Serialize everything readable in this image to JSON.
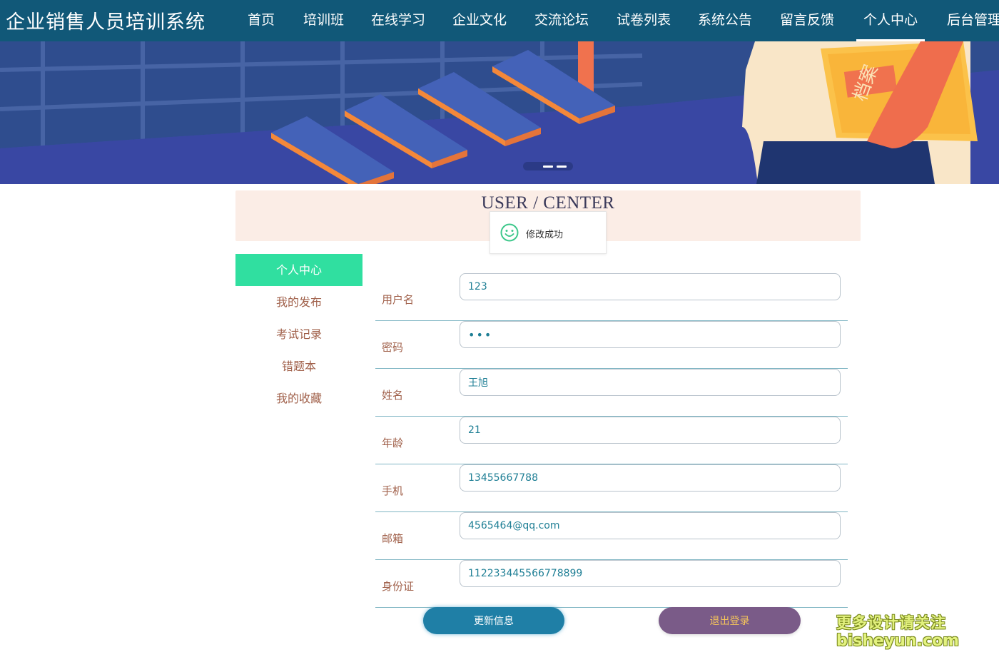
{
  "header": {
    "site_title": "企业销售人员培训系统",
    "nav": [
      "首页",
      "培训班",
      "在线学习",
      "企业文化",
      "交流论坛",
      "试卷列表",
      "系统公告",
      "留言反馈",
      "个人中心",
      "后台管理"
    ],
    "active_nav": "个人中心"
  },
  "banner": {
    "folder_text": "档案"
  },
  "user_center": {
    "title": "USER / CENTER"
  },
  "toast": {
    "icon": "smile-icon",
    "message": "修改成功"
  },
  "side_menu": {
    "items": [
      "个人中心",
      "我的发布",
      "考试记录",
      "错题本",
      "我的收藏"
    ],
    "active": "个人中心"
  },
  "form": {
    "fields": [
      {
        "label": "用户名",
        "value": "123"
      },
      {
        "label": "密码",
        "value": "123"
      },
      {
        "label": "姓名",
        "value": "王旭"
      },
      {
        "label": "年龄",
        "value": "21"
      },
      {
        "label": "手机",
        "value": "13455667788"
      },
      {
        "label": "邮箱",
        "value": "4565464@qq.com"
      },
      {
        "label": "身份证",
        "value": "112233445566778899"
      }
    ],
    "update_button": "更新信息",
    "logout_button": "退出登录"
  },
  "watermark": {
    "line1": "更多设计请关注",
    "line2": "bisheyun.com"
  },
  "colors": {
    "topbar": "#115878",
    "active_side": "#30dfa0",
    "update_button": "#1f7fa6",
    "logout_button": "#7a5b88"
  }
}
